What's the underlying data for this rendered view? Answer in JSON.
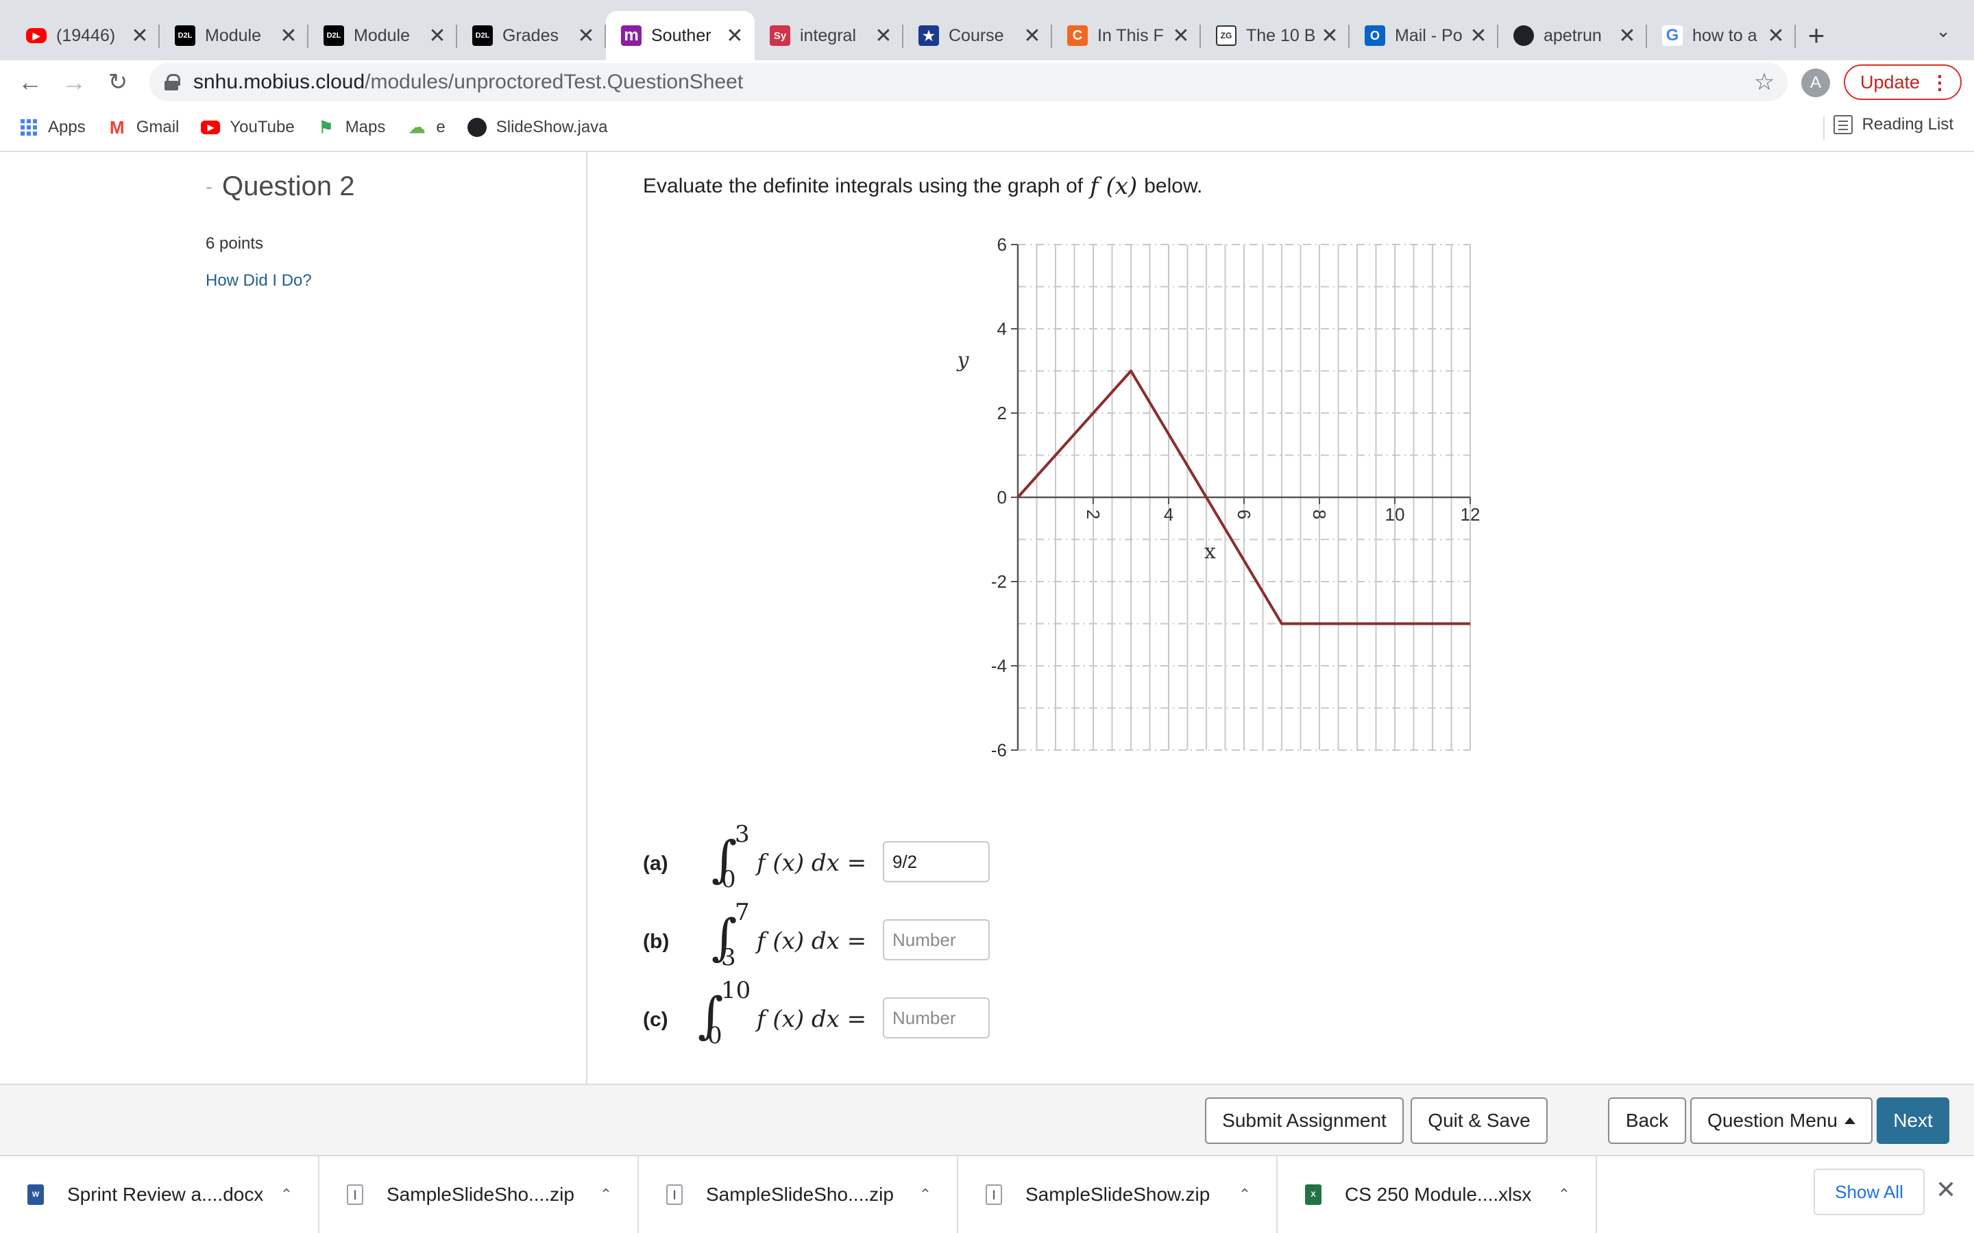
{
  "browser": {
    "tabs": [
      {
        "title": "(19446)",
        "icon": "youtube-icon",
        "color": "#ff0000"
      },
      {
        "title": "Module",
        "icon": "d2l-icon",
        "color": "#000000"
      },
      {
        "title": "Module",
        "icon": "d2l-icon",
        "color": "#000000"
      },
      {
        "title": "Grades",
        "icon": "d2l-icon",
        "color": "#000000"
      },
      {
        "title": "Souther",
        "icon": "mobius-icon",
        "color": "#8a1fa6",
        "active": true
      },
      {
        "title": "integral",
        "icon": "symbolab-icon",
        "color": "#d2334c"
      },
      {
        "title": "Course",
        "icon": "star-badge-icon",
        "color": "#1a3a8f"
      },
      {
        "title": "In This F",
        "icon": "chegg-icon",
        "color": "#f26722"
      },
      {
        "title": "The 10 B",
        "icon": "zg-icon",
        "color": "#ffffff"
      },
      {
        "title": "Mail - Po",
        "icon": "outlook-icon",
        "color": "#0a64c8"
      },
      {
        "title": "apetrun",
        "icon": "github-icon",
        "color": "#202124"
      },
      {
        "title": "how to a",
        "icon": "google-icon",
        "color": "#4285f4"
      }
    ],
    "url_host": "snhu.mobius.cloud",
    "url_path": "/modules/unproctoredTest.QuestionSheet",
    "profile_initial": "A",
    "update_label": "Update",
    "bookmarks": [
      {
        "label": "Apps",
        "icon": "apps-grid-icon"
      },
      {
        "label": "Gmail",
        "icon": "gmail-icon"
      },
      {
        "label": "YouTube",
        "icon": "youtube-icon"
      },
      {
        "label": "Maps",
        "icon": "maps-icon"
      },
      {
        "label": "e",
        "icon": "bookmark-e-icon"
      },
      {
        "label": "SlideShow.java",
        "icon": "github-icon"
      }
    ],
    "reading_list_label": "Reading List"
  },
  "question": {
    "title": "Question 2",
    "points": "6 points",
    "how_did_i_do": "How Did I Do?",
    "instruction_pre": "Evaluate the definite integrals using the graph of",
    "instruction_math": "f (x)",
    "instruction_post": "below.",
    "parts": [
      {
        "label": "(a)",
        "lower": "0",
        "upper": "3",
        "expr": "f (x) dx =",
        "value": "9/2",
        "placeholder": "Number"
      },
      {
        "label": "(b)",
        "lower": "3",
        "upper": "7",
        "expr": "f (x) dx =",
        "value": "",
        "placeholder": "Number"
      },
      {
        "label": "(c)",
        "lower": "0",
        "upper": "10",
        "expr": "f (x) dx =",
        "value": "",
        "placeholder": "Number"
      }
    ]
  },
  "chart_data": {
    "type": "line",
    "xlabel": "x",
    "ylabel": "y",
    "xlim": [
      0,
      12
    ],
    "ylim": [
      -6,
      6
    ],
    "xticks": [
      "2",
      "4",
      "6",
      "8",
      "10",
      "12"
    ],
    "yticks": [
      "6",
      "4",
      "2",
      "0",
      "-2",
      "-4",
      "-6"
    ],
    "grid": true,
    "line_color": "#8b2e2e",
    "series": [
      {
        "x": [
          0,
          3,
          7,
          12
        ],
        "y": [
          0,
          3,
          -3,
          -3
        ]
      }
    ]
  },
  "actions": {
    "submit": "Submit Assignment",
    "quit_save": "Quit & Save",
    "back": "Back",
    "question_menu": "Question Menu",
    "next": "Next"
  },
  "downloads": {
    "items": [
      {
        "name": "Sprint Review a....docx",
        "icon": "word-file-icon",
        "color": "#2b579a"
      },
      {
        "name": "SampleSlideSho....zip",
        "icon": "zip-file-icon",
        "color": "#9aa0a6"
      },
      {
        "name": "SampleSlideSho....zip",
        "icon": "zip-file-icon",
        "color": "#9aa0a6"
      },
      {
        "name": "SampleSlideShow.zip",
        "icon": "zip-file-icon",
        "color": "#9aa0a6"
      },
      {
        "name": "CS 250 Module....xlsx",
        "icon": "excel-file-icon",
        "color": "#217346"
      }
    ],
    "show_all": "Show All"
  }
}
